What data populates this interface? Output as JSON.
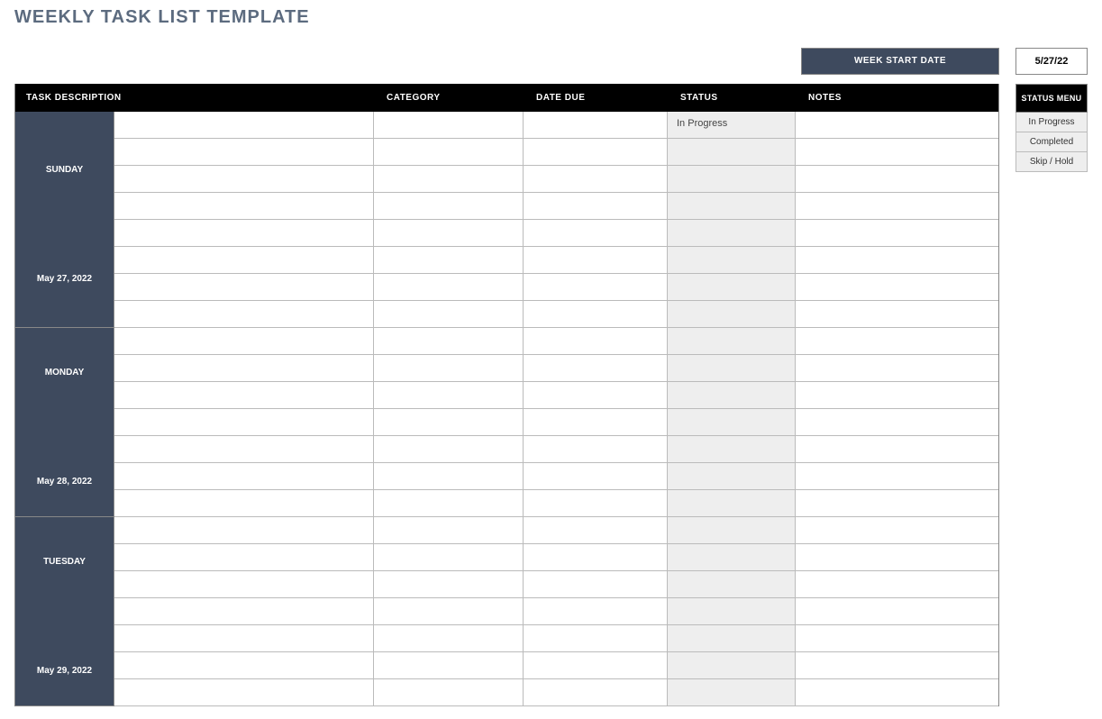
{
  "title": "WEEKLY TASK LIST TEMPLATE",
  "week_start_date": {
    "label": "WEEK START DATE",
    "value": "5/27/22"
  },
  "columns": {
    "task_description": "TASK DESCRIPTION",
    "category": "CATEGORY",
    "date_due": "DATE DUE",
    "status": "STATUS",
    "notes": "NOTES"
  },
  "status_menu": {
    "header": "STATUS MENU",
    "items": [
      "In Progress",
      "Completed",
      "Skip / Hold"
    ]
  },
  "days": [
    {
      "name": "SUNDAY",
      "date": "May 27, 2022",
      "rows": [
        {
          "task": "",
          "category": "",
          "due": "",
          "status": "In Progress",
          "notes": ""
        },
        {
          "task": "",
          "category": "",
          "due": "",
          "status": "",
          "notes": ""
        },
        {
          "task": "",
          "category": "",
          "due": "",
          "status": "",
          "notes": ""
        },
        {
          "task": "",
          "category": "",
          "due": "",
          "status": "",
          "notes": ""
        },
        {
          "task": "",
          "category": "",
          "due": "",
          "status": "",
          "notes": ""
        },
        {
          "task": "",
          "category": "",
          "due": "",
          "status": "",
          "notes": ""
        },
        {
          "task": "",
          "category": "",
          "due": "",
          "status": "",
          "notes": ""
        },
        {
          "task": "",
          "category": "",
          "due": "",
          "status": "",
          "notes": ""
        }
      ]
    },
    {
      "name": "MONDAY",
      "date": "May 28, 2022",
      "rows": [
        {
          "task": "",
          "category": "",
          "due": "",
          "status": "",
          "notes": ""
        },
        {
          "task": "",
          "category": "",
          "due": "",
          "status": "",
          "notes": ""
        },
        {
          "task": "",
          "category": "",
          "due": "",
          "status": "",
          "notes": ""
        },
        {
          "task": "",
          "category": "",
          "due": "",
          "status": "",
          "notes": ""
        },
        {
          "task": "",
          "category": "",
          "due": "",
          "status": "",
          "notes": ""
        },
        {
          "task": "",
          "category": "",
          "due": "",
          "status": "",
          "notes": ""
        },
        {
          "task": "",
          "category": "",
          "due": "",
          "status": "",
          "notes": ""
        }
      ]
    },
    {
      "name": "TUESDAY",
      "date": "May 29, 2022",
      "rows": [
        {
          "task": "",
          "category": "",
          "due": "",
          "status": "",
          "notes": ""
        },
        {
          "task": "",
          "category": "",
          "due": "",
          "status": "",
          "notes": ""
        },
        {
          "task": "",
          "category": "",
          "due": "",
          "status": "",
          "notes": ""
        },
        {
          "task": "",
          "category": "",
          "due": "",
          "status": "",
          "notes": ""
        },
        {
          "task": "",
          "category": "",
          "due": "",
          "status": "",
          "notes": ""
        },
        {
          "task": "",
          "category": "",
          "due": "",
          "status": "",
          "notes": ""
        },
        {
          "task": "",
          "category": "",
          "due": "",
          "status": "",
          "notes": ""
        }
      ]
    }
  ]
}
